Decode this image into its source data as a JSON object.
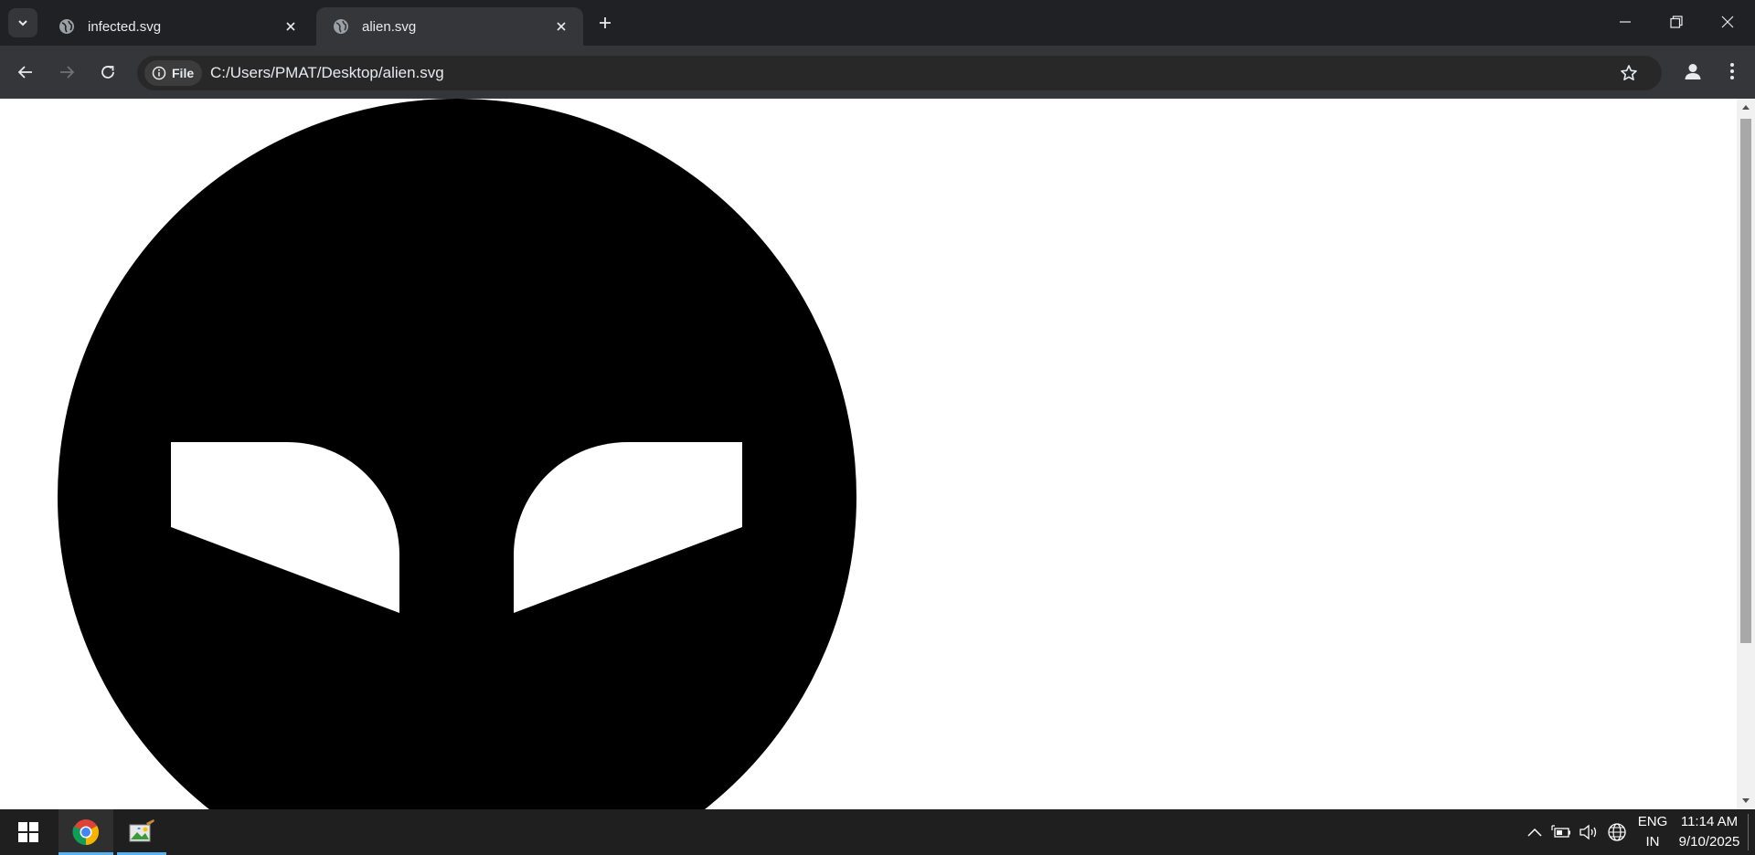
{
  "browser": {
    "tabs": [
      {
        "title": "infected.svg",
        "active": false
      },
      {
        "title": "alien.svg",
        "active": true
      }
    ],
    "address": {
      "scheme_chip": "File",
      "url": "C:/Users/PMAT/Desktop/alien.svg"
    }
  },
  "page": {
    "image": "alien face svg (black circle with two white eyes)",
    "colors": {
      "background": "#ffffff",
      "face": "#000000",
      "eyes": "#ffffff"
    },
    "scroll_position_fraction": 0.0
  },
  "taskbar": {
    "apps": [
      {
        "name": "chrome-icon",
        "active": true
      },
      {
        "name": "paint-icon",
        "active": true
      }
    ],
    "tray": {
      "language_top": "ENG",
      "language_bottom": "IN",
      "time": "11:14 AM",
      "date": "9/10/2025"
    }
  },
  "colors": {
    "titlebar": "#202124",
    "toolbar": "#35363a",
    "omnibox": "#282828",
    "taskbar": "#1f1f1f",
    "taskbar_accent": "#5ab1ef"
  }
}
